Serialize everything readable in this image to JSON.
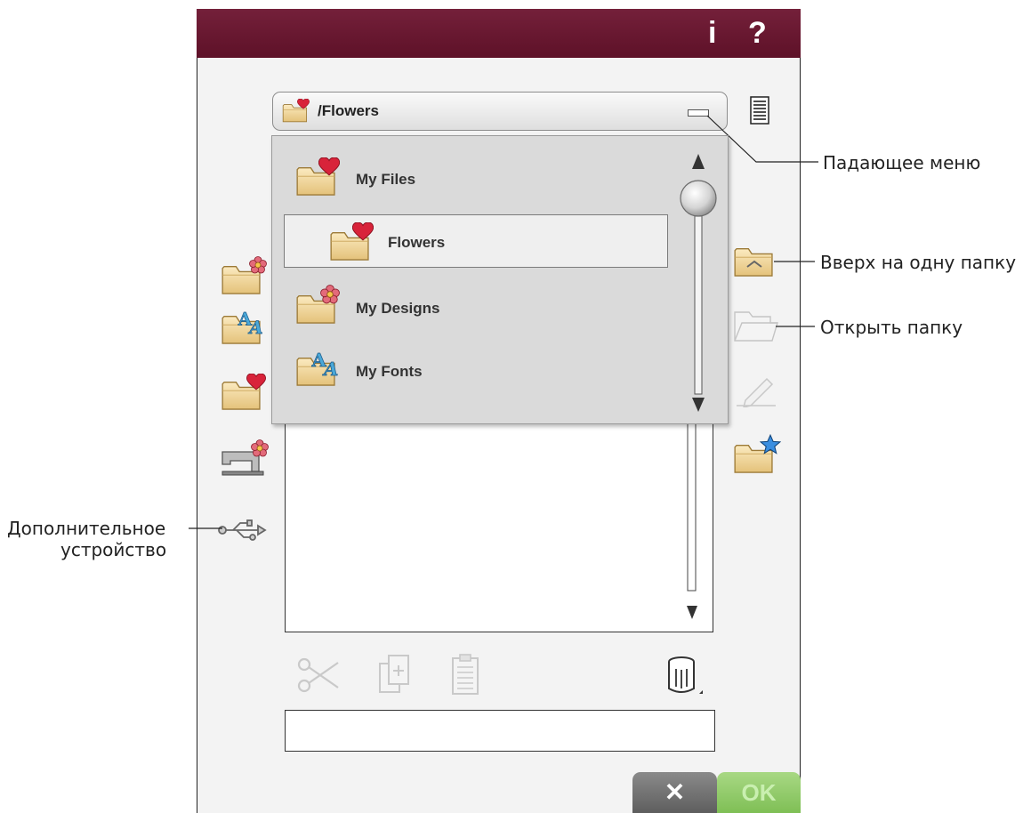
{
  "titlebar": {
    "info_label": "i",
    "help_label": "?"
  },
  "path": {
    "current": "/Flowers"
  },
  "dropdown": {
    "items": [
      {
        "label": "My Files",
        "icon": "folder-heart-icon",
        "selected": false
      },
      {
        "label": "Flowers",
        "icon": "folder-heart-icon",
        "selected": true
      },
      {
        "label": "My Designs",
        "icon": "folder-flower-icon",
        "selected": false
      },
      {
        "label": "My Fonts",
        "icon": "folder-font-icon",
        "selected": false
      }
    ]
  },
  "left_tools": [
    {
      "icon": "folder-flower-icon"
    },
    {
      "icon": "folder-font-icon"
    },
    {
      "icon": "folder-heart-icon"
    },
    {
      "icon": "machine-flower-icon"
    },
    {
      "icon": "usb-icon"
    }
  ],
  "right_tools": [
    {
      "icon": "folder-up-icon"
    },
    {
      "icon": "folder-open-icon"
    },
    {
      "icon": "pencil-icon"
    },
    {
      "icon": "folder-star-icon"
    }
  ],
  "edit_tools": [
    {
      "icon": "scissors-icon"
    },
    {
      "icon": "copy-icon"
    },
    {
      "icon": "paste-icon"
    },
    {
      "icon": "trash-icon"
    }
  ],
  "buttons": {
    "cancel_label": "✕",
    "ok_label": "OK"
  },
  "callouts": {
    "dropdown_menu": "Падающее меню",
    "folder_up": "Вверх на одну папку",
    "open_folder": "Открыть папку",
    "external_device_line1": "Дополнительное",
    "external_device_line2": "устройство"
  },
  "colors": {
    "titlebar": "#6a1830",
    "ok": "#8cc866",
    "folder": "#efd08a",
    "heart": "#d8233a"
  }
}
